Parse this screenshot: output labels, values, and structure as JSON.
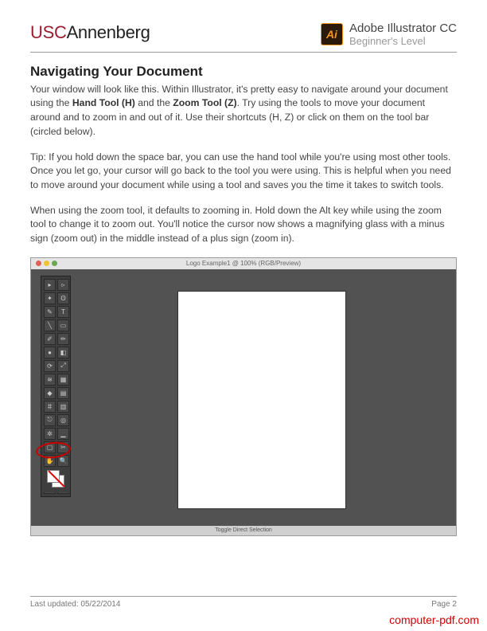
{
  "header": {
    "brand_usc": "USC",
    "brand_ann": "Annenberg",
    "ai_badge": "Ai",
    "app_title": "Adobe Illustrator CC",
    "app_subtitle": "Beginner's Level"
  },
  "section": {
    "title": "Navigating Your Document",
    "para1_a": "Your window will look like this. Within Illustrator, it's pretty easy to navigate around your document using the ",
    "hand_tool": "Hand Tool (H)",
    "para1_b": " and the ",
    "zoom_tool": "Zoom Tool (Z)",
    "para1_c": ". Try using the tools to move your document around and to zoom in and out of it. Use their shortcuts (H, Z) or click on them on the tool bar (circled below).",
    "para2": "Tip: If you hold down the space bar, you can use the hand tool while you're using most other tools. Once you let go, your cursor will go back to the tool you were using. This is helpful when you need to move around your document while using a tool and saves you the time it takes to switch tools.",
    "para3": "When using the zoom tool, it defaults to zooming in. Hold down the Alt key while using the zoom tool to change it to zoom out. You'll notice the cursor now shows a magnifying glass with a minus sign (zoom out) in the middle instead of a plus sign (zoom in)."
  },
  "screenshot": {
    "window_title": "Logo Example1 @ 100% (RGB/Preview)",
    "status_text": "Toggle Direct Selection"
  },
  "footer": {
    "updated": "Last updated: 05/22/2014",
    "page": "Page  2"
  },
  "watermark": "computer-pdf.com"
}
